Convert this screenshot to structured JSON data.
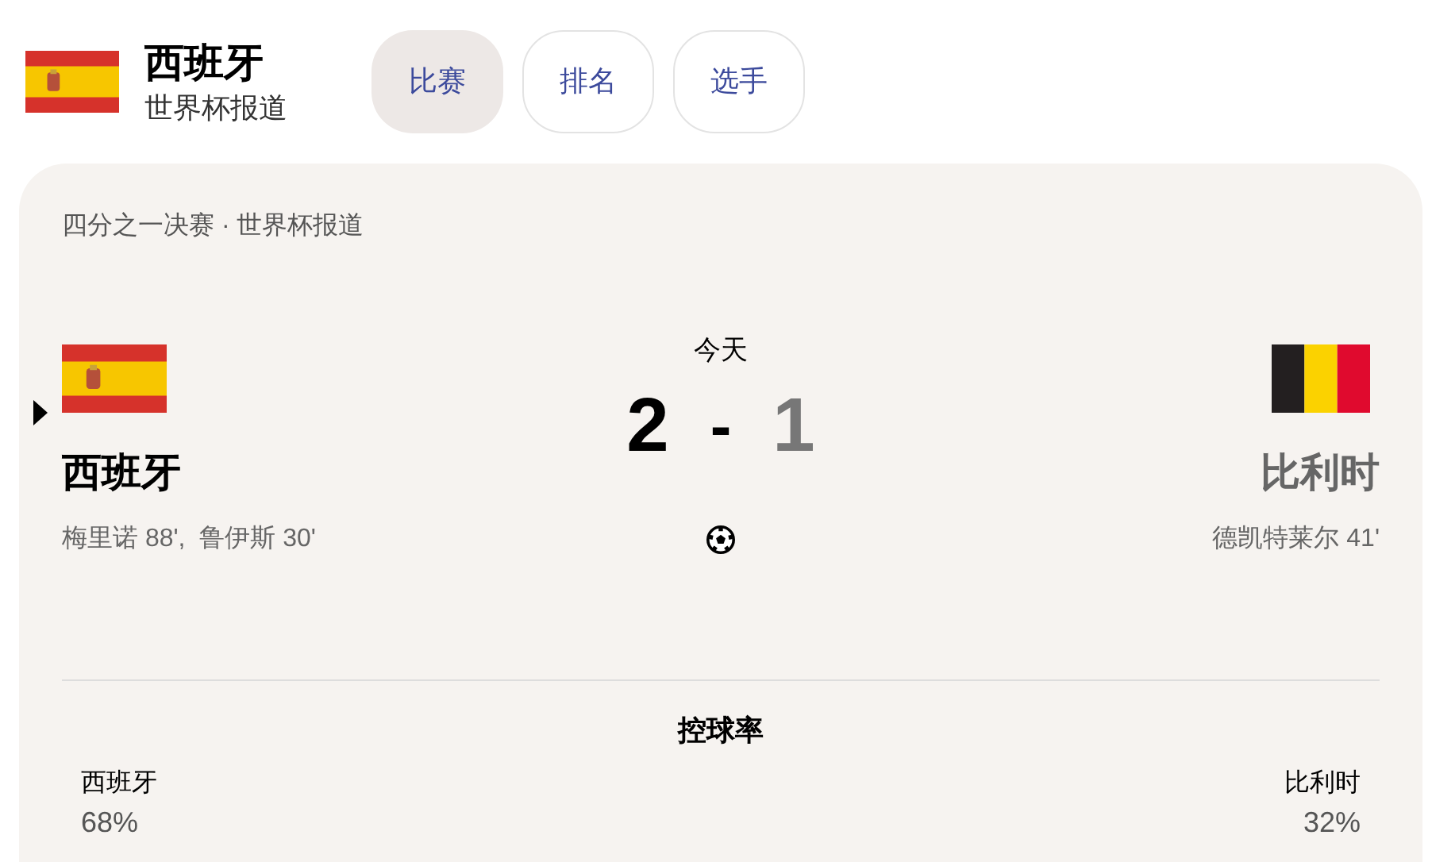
{
  "header": {
    "kind": "spain",
    "team": "西班牙",
    "subtitle": "世界杯报道"
  },
  "tabs": [
    {
      "label": "比赛",
      "selected": true
    },
    {
      "label": "排名",
      "selected": false
    },
    {
      "label": "选手",
      "selected": false
    }
  ],
  "match": {
    "stage": "四分之一决赛 · 世界杯报道",
    "date": "今天",
    "separator": "-",
    "teams": [
      {
        "name": "西班牙",
        "kind": "spain",
        "score": "2",
        "winner": true,
        "scorers": "梅里诺 88',  鲁伊斯 30'"
      },
      {
        "name": "比利时",
        "kind": "belgium",
        "score": "1",
        "winner": false,
        "scorers": "德凯特莱尔 41'"
      }
    ]
  },
  "stats": {
    "title": "控球率",
    "values": [
      {
        "team": "西班牙",
        "value": "68%"
      },
      {
        "team": "比利时",
        "value": "32%"
      }
    ]
  }
}
